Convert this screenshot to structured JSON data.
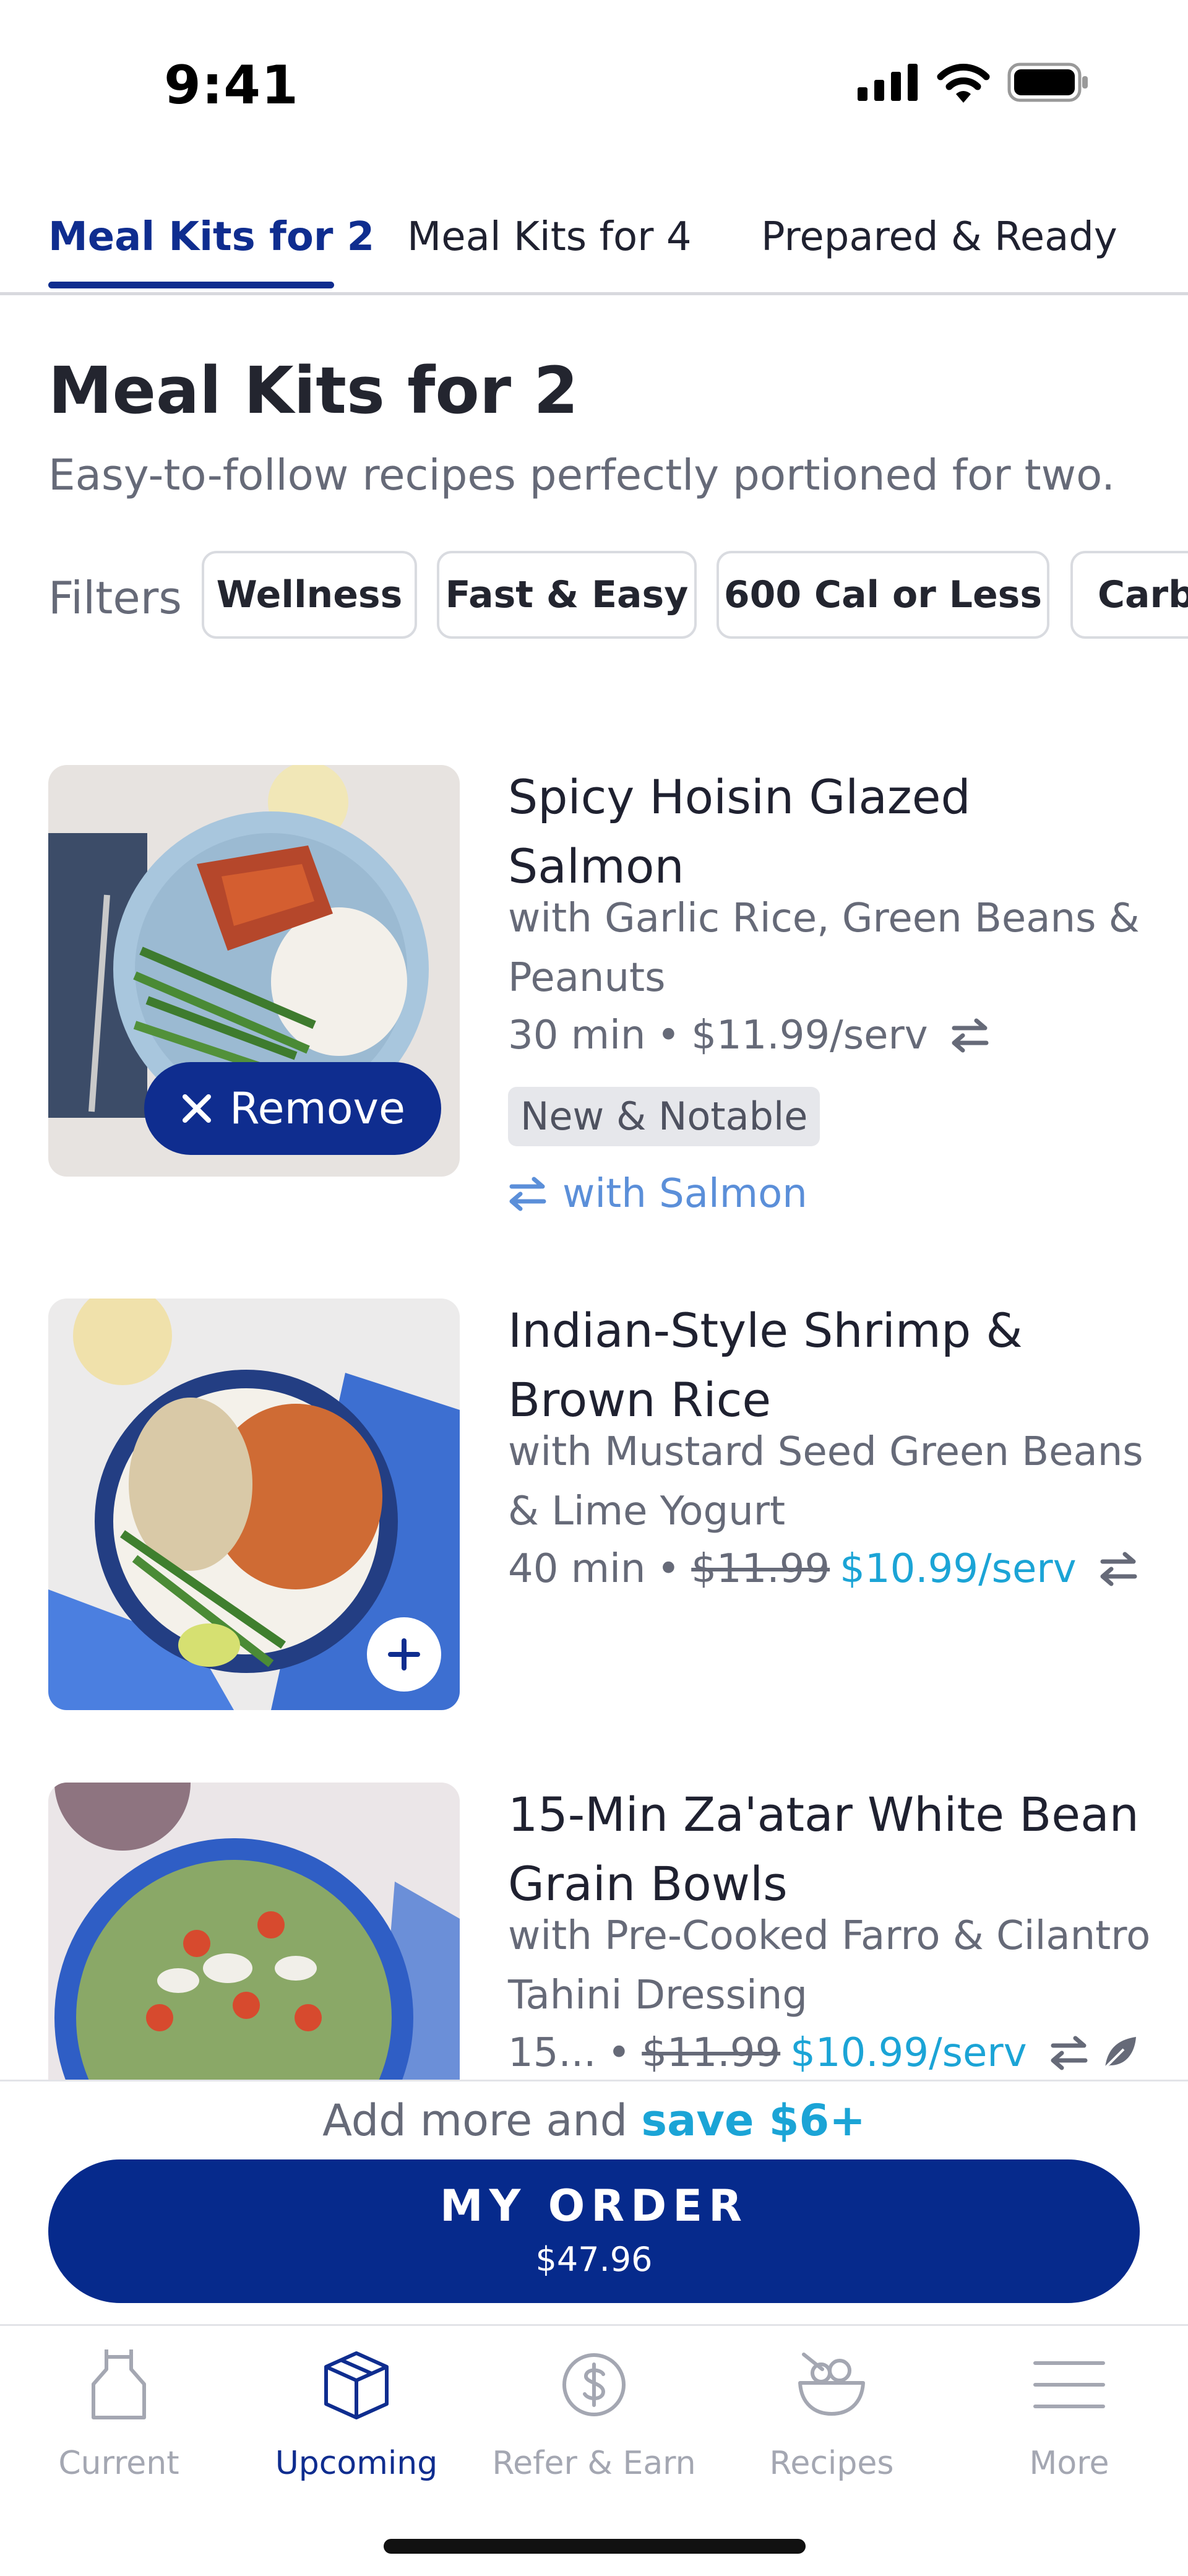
{
  "status_bar": {
    "time": "9:41"
  },
  "tabs": [
    {
      "label": "Meal Kits for 2",
      "active": true
    },
    {
      "label": "Meal Kits for 4",
      "active": false
    },
    {
      "label": "Prepared & Ready",
      "active": false
    }
  ],
  "section": {
    "title": "Meal Kits for 2",
    "subtitle": "Easy-to-follow recipes perfectly portioned for two."
  },
  "filters": {
    "label": "Filters",
    "chips": [
      "Wellness",
      "Fast & Easy",
      "600 Cal or Less",
      "Carb"
    ]
  },
  "meals": [
    {
      "title": "Spicy Hoisin Glazed Salmon",
      "description": "with Garlic Rice, Green Beans & Peanuts",
      "time": "30 min",
      "separator": "•",
      "price": "$11.99/serv",
      "badge": "New & Notable",
      "swap_link": "with Salmon",
      "action": "Remove",
      "in_order": true
    },
    {
      "title": "Indian-Style Shrimp & Brown Rice",
      "description": "with Mustard Seed Green Beans & Lime Yogurt",
      "time": "40 min",
      "separator": "•",
      "original_price": "$11.99",
      "sale_price": "$10.99/serv",
      "in_order": false
    },
    {
      "title": "15-Min Za'atar White Bean Grain Bowls",
      "description": "with Pre-Cooked Farro & Cilantro Tahini Dressing",
      "time": "15...",
      "separator": "•",
      "original_price": "$11.99",
      "sale_price": "$10.99/serv",
      "in_order": false
    }
  ],
  "save_bar": {
    "prefix": "Add more and ",
    "highlight": "save $6+"
  },
  "order_button": {
    "label": "MY ORDER",
    "total": "$47.96"
  },
  "bottom_nav": [
    {
      "label": "Current",
      "icon": "apron-icon",
      "active": false
    },
    {
      "label": "Upcoming",
      "icon": "box-icon",
      "active": true
    },
    {
      "label": "Refer & Earn",
      "icon": "dollar-coin-icon",
      "active": false
    },
    {
      "label": "Recipes",
      "icon": "bowl-icon",
      "active": false
    },
    {
      "label": "More",
      "icon": "menu-icon",
      "active": false
    }
  ],
  "colors": {
    "brand_blue": "#0f2d8f",
    "sale_blue": "#1ba4d6",
    "link_blue": "#5b8fd9",
    "muted_text": "#666a78"
  }
}
